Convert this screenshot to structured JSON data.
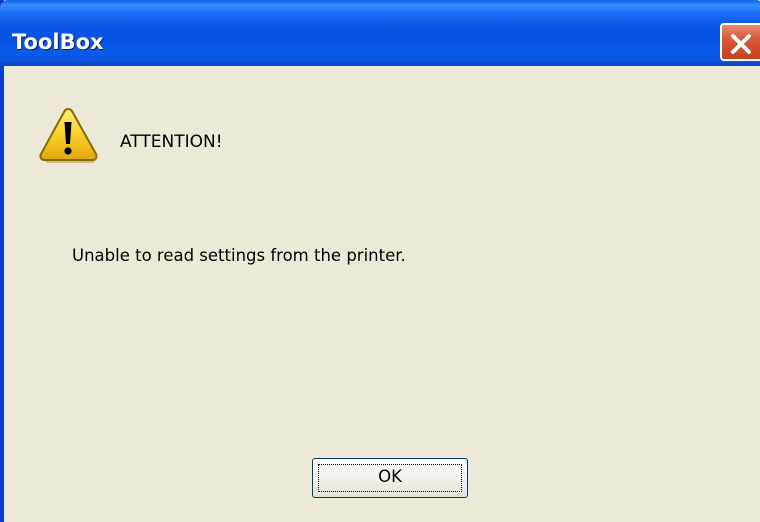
{
  "window": {
    "title": "ToolBox",
    "close_icon": "close-icon"
  },
  "dialog": {
    "icon": "warning-icon",
    "heading": "ATTENTION!",
    "message": "Unable to read settings from the printer.",
    "ok_label": "OK"
  },
  "colors": {
    "titlebar": "#0A55E6",
    "body": "#ECE9D8",
    "close_button": "#D9573C",
    "warning_yellow": "#F8D02A"
  }
}
